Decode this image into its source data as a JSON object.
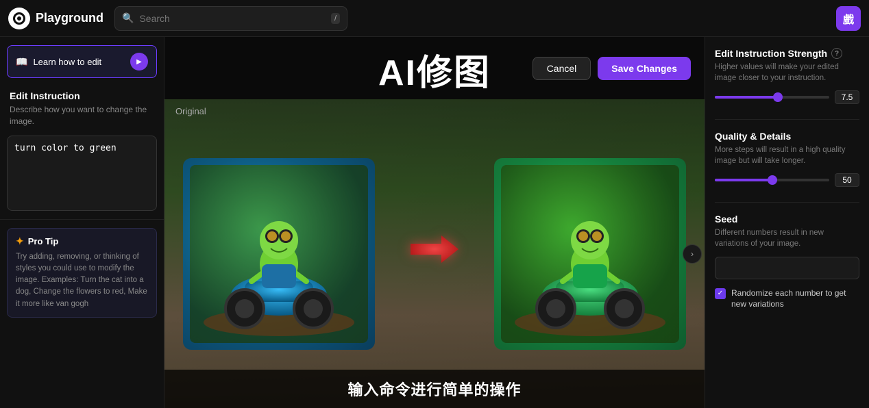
{
  "topnav": {
    "brand_name": "Playground",
    "search_placeholder": "Search",
    "search_shortcut": "/",
    "avatar_letter": "戲"
  },
  "sidebar": {
    "learn_btn_label": "Learn how to edit",
    "edit_instruction_title": "Edit Instruction",
    "edit_instruction_desc": "Describe how you want to change the image.",
    "edit_instruction_value": "turn color to green",
    "pro_tip_title": "Pro Tip",
    "pro_tip_text": "Try adding, removing, or thinking of styles you could use to modify the image. Examples: Turn the cat into a dog, Change the flowers to red, Make it more like van gogh"
  },
  "center": {
    "title": "AI修图",
    "original_label": "Original",
    "cancel_label": "Cancel",
    "save_label": "Save Changes",
    "bottom_text": "输入命令进行简单的操作",
    "arrow_symbol": "➜"
  },
  "right_sidebar": {
    "edit_strength_title": "Edit Instruction Strength",
    "edit_strength_desc": "Higher values will make your edited image closer to your instruction.",
    "edit_strength_value": "7.5",
    "edit_strength_pct": 55,
    "quality_title": "Quality & Details",
    "quality_desc": "More steps will result in a high quality image but will take longer.",
    "quality_value": "50",
    "quality_pct": 50,
    "seed_title": "Seed",
    "seed_desc": "Different numbers result in new variations of your image.",
    "seed_placeholder": "",
    "randomize_label": "Randomize each number to get new variations"
  }
}
